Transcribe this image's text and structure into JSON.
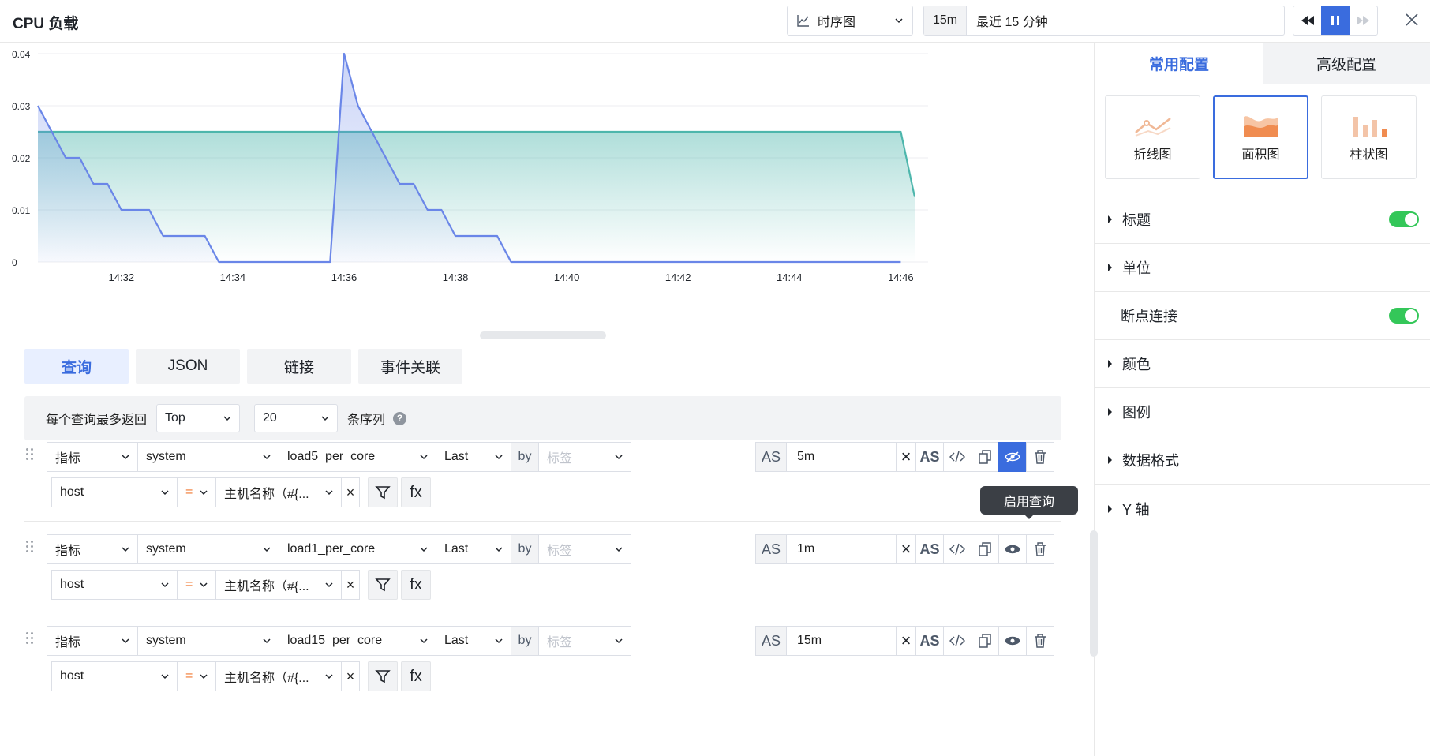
{
  "header": {
    "title": "CPU 负载",
    "viz_type": "时序图",
    "time_short": "15m",
    "time_range": "最近 15 分钟"
  },
  "chart_data": {
    "type": "area",
    "x": [
      "14:31:00",
      "14:31:30",
      "14:32:00",
      "14:32:30",
      "14:33:00",
      "14:33:30",
      "14:34:00",
      "14:34:30",
      "14:35:00",
      "14:35:30",
      "14:36:00",
      "14:36:30",
      "14:37:00",
      "14:37:30",
      "14:38:00",
      "14:38:30",
      "14:39:00",
      "14:39:30",
      "14:40:00",
      "14:40:30",
      "14:41:00",
      "14:41:30",
      "14:42:00",
      "14:42:30",
      "14:43:00",
      "14:43:30",
      "14:44:00",
      "14:44:30",
      "14:45:00",
      "14:45:30",
      "14:46:00"
    ],
    "xticks": [
      "14:32",
      "14:34",
      "14:36",
      "14:38",
      "14:40",
      "14:42",
      "14:44",
      "14:46"
    ],
    "yticks": [
      "0",
      "0.01",
      "0.02",
      "0.03",
      "0.04"
    ],
    "ylim": [
      0,
      0.04
    ],
    "series": [
      {
        "color": "#6a86e8",
        "points": [
          [
            "14:30:30",
            0.03
          ],
          [
            "14:30:45",
            0.025
          ],
          [
            "14:31:00",
            0.02
          ],
          [
            "14:31:15",
            0.02
          ],
          [
            "14:31:30",
            0.015
          ],
          [
            "14:31:45",
            0.015
          ],
          [
            "14:32:00",
            0.01
          ],
          [
            "14:32:30",
            0.01
          ],
          [
            "14:32:45",
            0.005
          ],
          [
            "14:33:30",
            0.005
          ],
          [
            "14:33:45",
            0.0
          ],
          [
            "14:35:45",
            0.0
          ],
          [
            "14:36:00",
            0.04
          ],
          [
            "14:36:15",
            0.03
          ],
          [
            "14:36:30",
            0.025
          ],
          [
            "14:36:45",
            0.02
          ],
          [
            "14:37:00",
            0.015
          ],
          [
            "14:37:15",
            0.015
          ],
          [
            "14:37:30",
            0.01
          ],
          [
            "14:37:45",
            0.01
          ],
          [
            "14:38:00",
            0.005
          ],
          [
            "14:38:45",
            0.005
          ],
          [
            "14:39:00",
            0.0
          ],
          [
            "14:46:00",
            0.0
          ]
        ]
      },
      {
        "color": "#4db6ac",
        "points": [
          [
            "14:30:30",
            0.025
          ],
          [
            "14:46:00",
            0.025
          ],
          [
            "14:46:15",
            0.0125
          ]
        ]
      }
    ]
  },
  "tabs": [
    "查询",
    "JSON",
    "链接",
    "事件关联"
  ],
  "limit": {
    "label": "每个查询最多返回",
    "mode": "Top",
    "count": "20",
    "suffix": "条序列",
    "help": "?"
  },
  "queries": [
    {
      "source": "指标",
      "namespace": "system",
      "metric": "load5_per_core",
      "agg": "Last",
      "by": "by",
      "tag_placeholder": "标签",
      "filter_key": "host",
      "op": "=",
      "filter_value": "主机名称（#{...",
      "alias_label": "AS",
      "alias": "5m",
      "clear": "×",
      "x_label": "×",
      "fx": "fx"
    },
    {
      "source": "指标",
      "namespace": "system",
      "metric": "load1_per_core",
      "agg": "Last",
      "by": "by",
      "tag_placeholder": "标签",
      "filter_key": "host",
      "op": "=",
      "filter_value": "主机名称（#{...",
      "alias_label": "AS",
      "alias": "1m",
      "clear": "×",
      "x_label": "×",
      "fx": "fx"
    },
    {
      "source": "指标",
      "namespace": "system",
      "metric": "load15_per_core",
      "agg": "Last",
      "by": "by",
      "tag_placeholder": "标签",
      "filter_key": "host",
      "op": "=",
      "filter_value": "主机名称（#{...",
      "alias_label": "AS",
      "alias": "15m",
      "clear": "×",
      "x_label": "×",
      "fx": "fx"
    }
  ],
  "tooltip": "启用查询",
  "right_panel": {
    "tabs": [
      "常用配置",
      "高级配置"
    ],
    "chart_types": [
      "折线图",
      "面积图",
      "柱状图"
    ],
    "sections": [
      "标题",
      "单位",
      "断点连接",
      "颜色",
      "图例",
      "数据格式",
      "Y 轴"
    ]
  },
  "colors": {
    "accent": "#3a6cde",
    "toggle_on": "#34c759",
    "series_1": "#6a86e8",
    "series_2": "#4db6ac"
  }
}
